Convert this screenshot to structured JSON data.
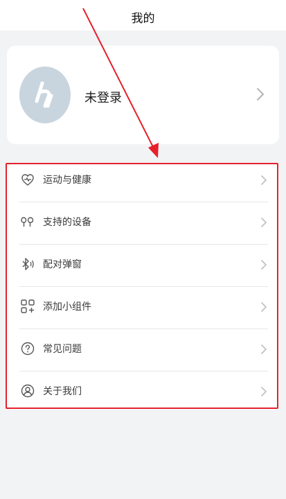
{
  "header": {
    "title": "我的"
  },
  "profile": {
    "name": "未登录",
    "avatar_icon": "user-avatar-icon",
    "chevron_icon": "chevron-right-icon"
  },
  "menu": {
    "items": [
      {
        "label": "运动与健康",
        "icon": "health-icon"
      },
      {
        "label": "支持的设备",
        "icon": "earbuds-icon"
      },
      {
        "label": "配对弹窗",
        "icon": "bluetooth-icon"
      },
      {
        "label": "添加小组件",
        "icon": "widget-add-icon"
      },
      {
        "label": "常见问题",
        "icon": "question-circle-icon"
      },
      {
        "label": "关于我们",
        "icon": "user-circle-icon"
      }
    ]
  },
  "colors": {
    "background": "#f1f3f5",
    "card": "#ffffff",
    "highlight_outline": "#e5202b",
    "avatar_bg": "#c9d5de"
  }
}
